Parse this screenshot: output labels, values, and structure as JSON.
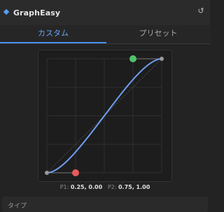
{
  "app": {
    "title": "GraphEasy",
    "accent": "#5b9cf2"
  },
  "tabs": [
    {
      "label": "カスタム",
      "active": true
    },
    {
      "label": "プリセット",
      "active": false
    }
  ],
  "curve": {
    "p1": {
      "x": 0.25,
      "y": 0.0
    },
    "p2": {
      "x": 0.75,
      "y": 1.0
    },
    "curve_color": "#6f9ef0",
    "p1_handle_color": "#e85a5a",
    "p2_handle_color": "#52c26a"
  },
  "readout": {
    "p1_label": "P1:",
    "p1_value": "0.25, 0.00",
    "p2_label": "P2:",
    "p2_value": "0.75, 1.00"
  },
  "type_section": {
    "label": "タイプ"
  }
}
